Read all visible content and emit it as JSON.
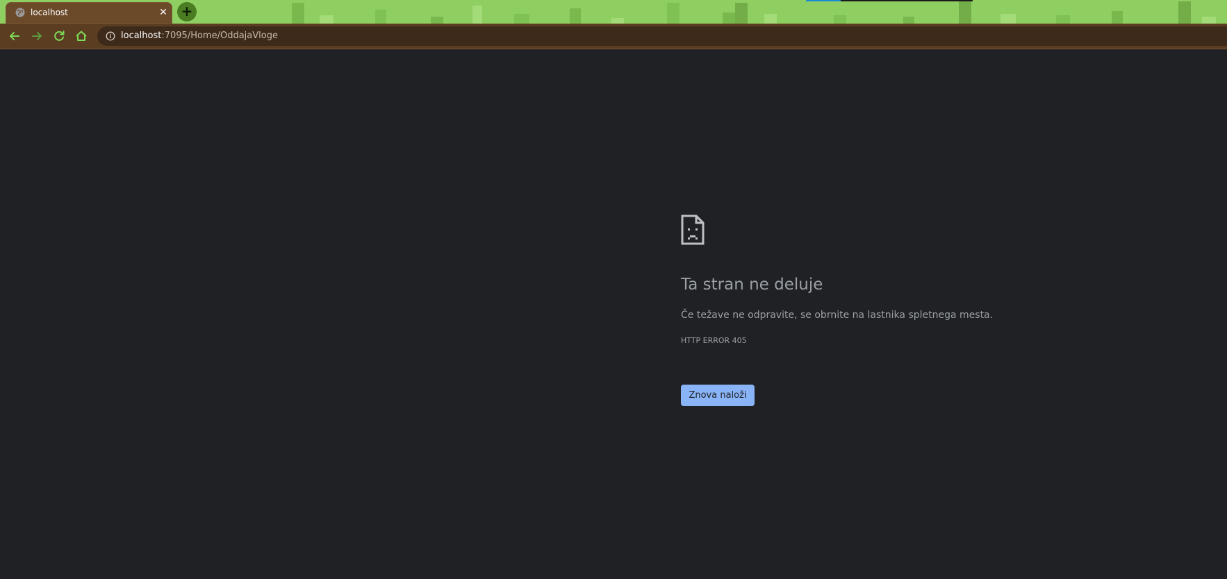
{
  "browser": {
    "tab": {
      "title": "localhost",
      "favicon": "globe-icon",
      "close_icon": "close-icon"
    },
    "new_tab_icon": "plus-icon",
    "toolbar": {
      "back_icon": "arrow-left-icon",
      "forward_icon": "arrow-right-icon",
      "reload_icon": "reload-icon",
      "home_icon": "home-icon",
      "site_info_icon": "info-icon"
    },
    "omnibox": {
      "host": "localhost",
      "path": ":7095/Home/OddajaVloge"
    },
    "theme_colors": {
      "tabstrip": "#8fcf62",
      "toolbar": "#5b3d22",
      "nav_icon": "#7ed957"
    }
  },
  "error_page": {
    "icon": "sad-page-icon",
    "title": "Ta stran ne deluje",
    "description": "Če težave ne odpravite, se obrnite na lastnika spletnega mesta.",
    "error_code": "HTTP ERROR 405",
    "reload_button": "Znova naloži",
    "colors": {
      "background": "#202124",
      "text": "#9aa0a6",
      "button": "#8ab4f8"
    }
  }
}
